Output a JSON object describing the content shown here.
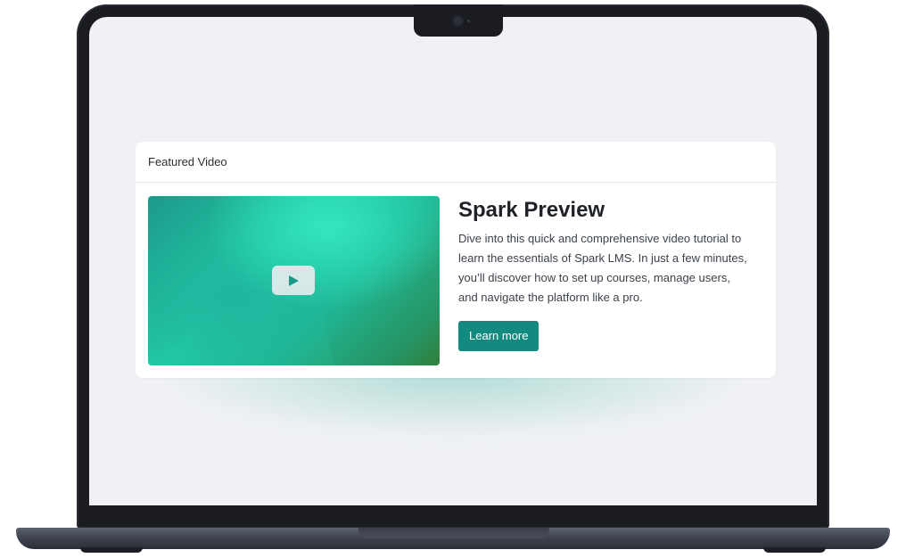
{
  "card": {
    "header": "Featured Video",
    "title": "Spark Preview",
    "description": "Dive into this quick and comprehensive video tutorial to learn the essentials of Spark LMS. In just a few minutes, you’ll discover how to set up courses, manage users, and navigate the platform like a pro.",
    "button_label": "Learn more"
  },
  "icons": {
    "play": "play-icon",
    "camera": "camera-icon"
  },
  "colors": {
    "accent": "#128a80",
    "screen_bg": "#eff1f4",
    "thumbnail_gradient_start": "#1c9a8a",
    "thumbnail_gradient_end": "#3b8a3c"
  }
}
